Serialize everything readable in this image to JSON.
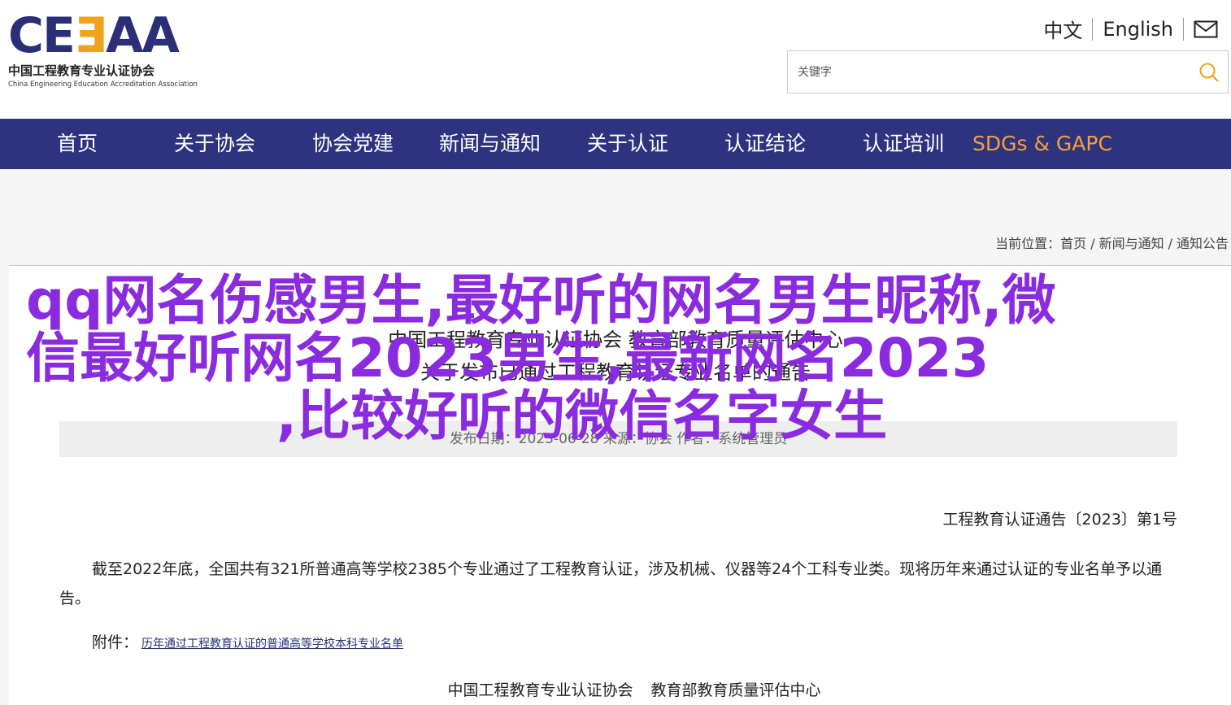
{
  "header": {
    "logo_mark_a": "CE",
    "logo_mark_b": "Ǝ",
    "logo_mark_c": "AA",
    "logo_cn": "中国工程教育专业认证协会",
    "logo_en": "China Engineering Education Accreditation Association",
    "lang_cn": "中文",
    "lang_en": "English",
    "search_placeholder": "关键字"
  },
  "nav": {
    "items": [
      {
        "label": "首页"
      },
      {
        "label": "关于协会"
      },
      {
        "label": "协会党建"
      },
      {
        "label": "新闻与通知"
      },
      {
        "label": "关于认证"
      },
      {
        "label": "认证结论"
      },
      {
        "label": "认证培训"
      },
      {
        "label": "SDGs & GAPC"
      }
    ]
  },
  "breadcrumb": {
    "prefix": "当前位置：",
    "items": [
      "首页",
      "新闻与通知",
      "通知公告"
    ]
  },
  "article": {
    "title_line1": "中国工程教育专业认证协会 教育部教育质量评估中心",
    "title_line2": "关于发布已通过工程教育认证专业名单的通告",
    "meta": "发布日期：2023-06-28    来源：协会    作者：系统管理员",
    "docno": "工程教育认证通告〔2023〕第1号",
    "paragraph": "截至2022年底，全国共有321所普通高等学校2385个专业通过了工程教育认证，涉及机械、仪器等24个工科专业类。现将历年来通过认证的专业名单予以通告。",
    "attach_label": "附件：",
    "attach_link": "历年通过工程教育认证的普通高等学校本科专业名单",
    "sign_a": "中国工程教育专业认证协会",
    "sign_b": "教育部教育质量评估中心"
  },
  "overlay": {
    "line1": "qq网名伤感男生,最好听的网名男生昵称,微",
    "line2": "信最好听网名2023男生,最新网名2023",
    "line3": ",比较好听的微信名字女生"
  },
  "colors": {
    "nav_bg": "#2e3380",
    "nav_highlight": "#f5a13a",
    "overlay_text": "#8b2be0",
    "logo_blue": "#2a2f78",
    "logo_orange": "#f0a21a"
  }
}
